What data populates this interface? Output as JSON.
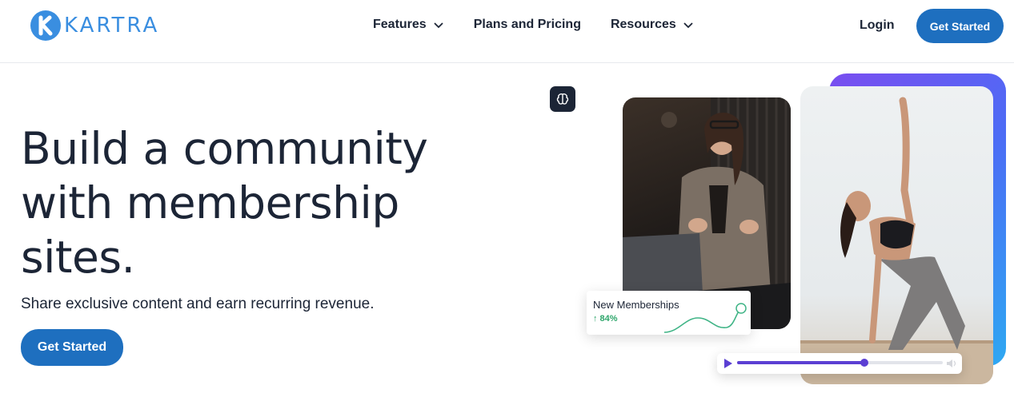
{
  "brand": {
    "name": "KARTRA",
    "color": "#3a8ee0"
  },
  "nav": {
    "items": [
      {
        "label": "Features",
        "has_dropdown": true
      },
      {
        "label": "Plans and Pricing",
        "has_dropdown": false
      },
      {
        "label": "Resources",
        "has_dropdown": true
      }
    ],
    "login_label": "Login",
    "cta_label": "Get Started"
  },
  "hero": {
    "title_lines": [
      "Build a community",
      "with membership",
      "sites."
    ],
    "subtitle": "Share exclusive content and earn recurring revenue.",
    "cta_label": "Get Started"
  },
  "visual": {
    "icon": "brain-icon",
    "stat_card": {
      "title": "New Memberships",
      "stat": "↑ 84%",
      "stat_color": "#2ea66b"
    },
    "player": {
      "progress": 0.62,
      "accent": "#5b3fd3"
    }
  },
  "colors": {
    "primary_button": "#1e6fbf",
    "text": "#1c2536"
  }
}
